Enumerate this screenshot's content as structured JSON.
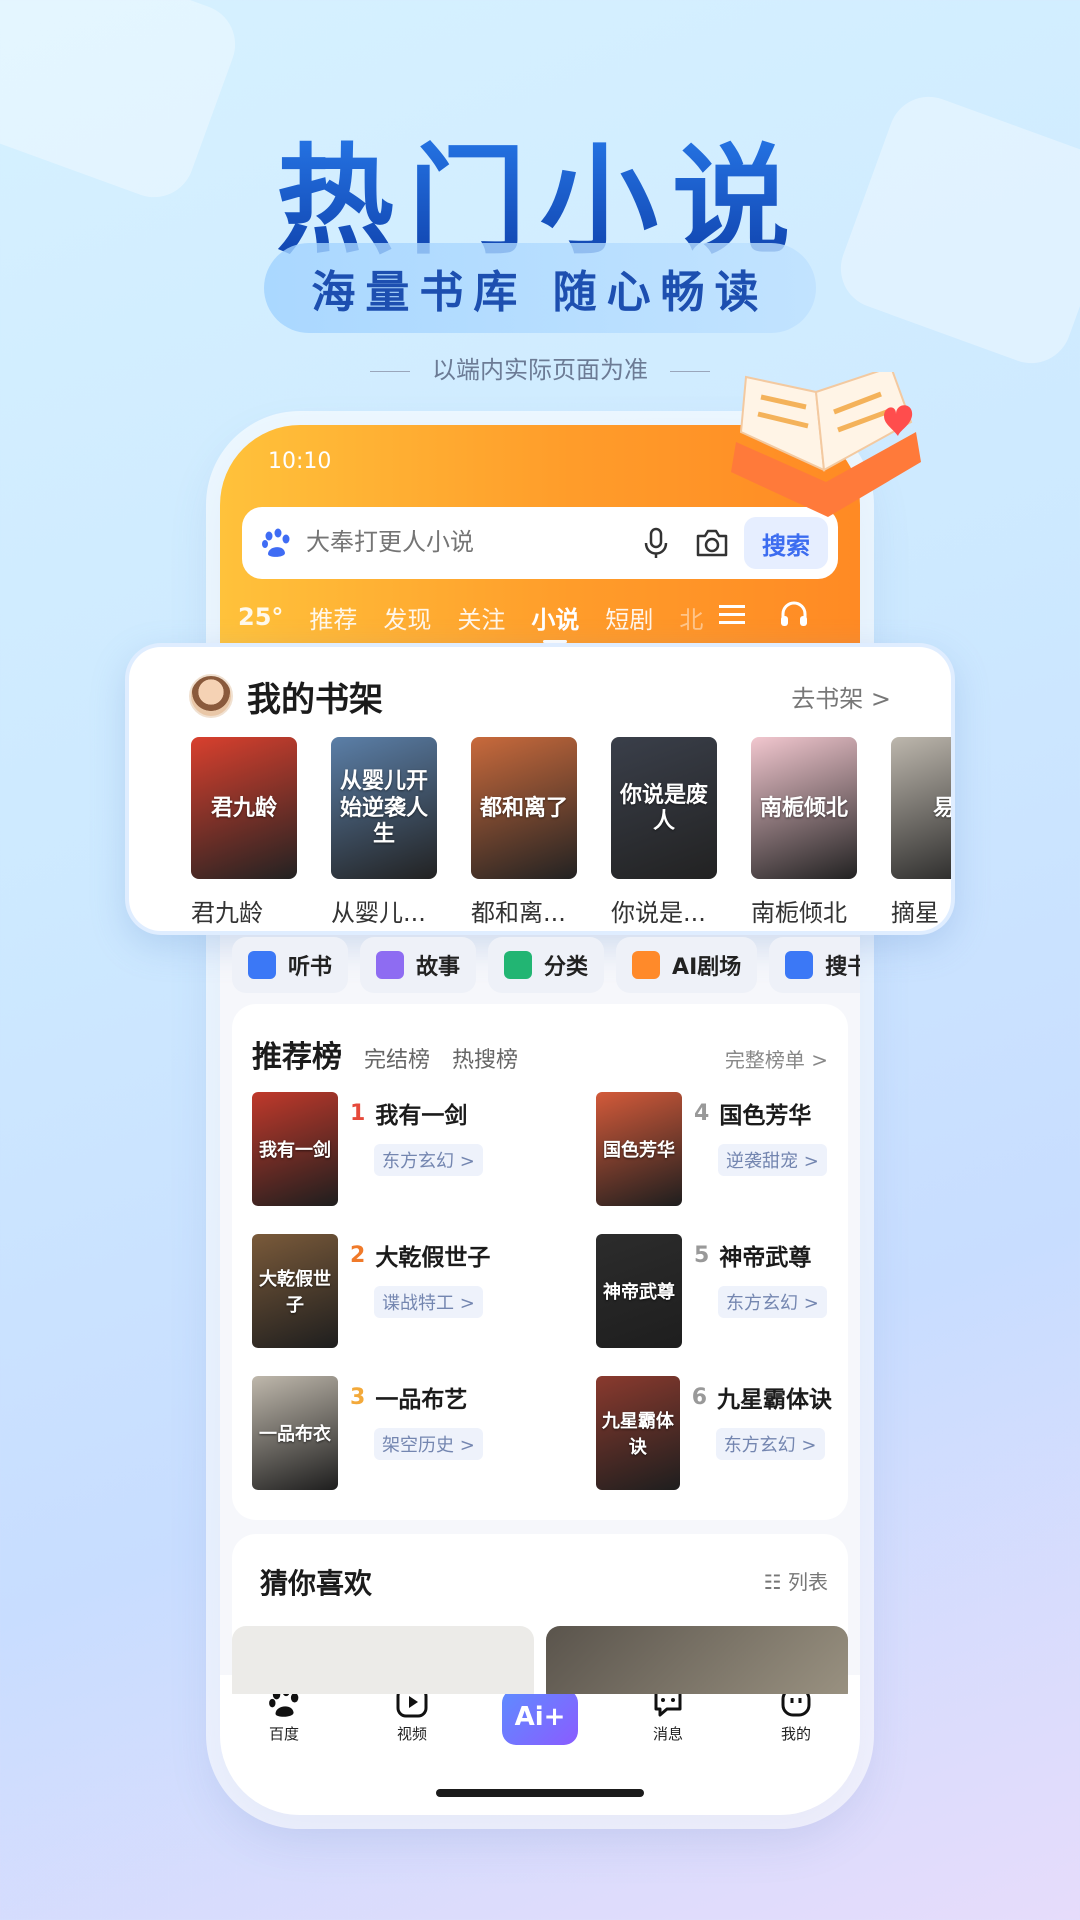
{
  "hero": {
    "title": "热门小说",
    "subtitle": "海量书库  随心畅读",
    "note": "以端内实际页面为准"
  },
  "status": {
    "time": "10:10"
  },
  "search": {
    "placeholder": "大奉打更人小说",
    "button": "搜索"
  },
  "top_tabs": {
    "temperature": "25°",
    "items": [
      "推荐",
      "发现",
      "关注",
      "小说",
      "短剧",
      "北"
    ],
    "active": "小说"
  },
  "shelf": {
    "title": "我的书架",
    "link": "去书架 >",
    "books": [
      {
        "name": "君九龄",
        "cover_text": "君九龄",
        "color": "#d9402e"
      },
      {
        "name": "从婴儿...",
        "cover_text": "从婴儿开始逆袭人生",
        "color": "#5b7fa8"
      },
      {
        "name": "都和离...",
        "cover_text": "都和离了",
        "color": "#c96a3c"
      },
      {
        "name": "你说是...",
        "cover_text": "你说是废人",
        "color": "#3a3f4a"
      },
      {
        "name": "南栀倾北",
        "cover_text": "南栀倾北",
        "color": "#f2c7cf"
      },
      {
        "name": "摘星",
        "cover_text": "易",
        "color": "#bdb7ad"
      }
    ]
  },
  "features": [
    {
      "label": "听书",
      "color": "#3b78f6"
    },
    {
      "label": "故事",
      "color": "#8e6cf2"
    },
    {
      "label": "分类",
      "color": "#22b573"
    },
    {
      "label": "AI剧场",
      "color": "#ff8a2a"
    },
    {
      "label": "搜书",
      "color": "#3b78f6"
    }
  ],
  "ranking": {
    "tab_main": "推荐榜",
    "tabs": [
      "完结榜",
      "热搜榜"
    ],
    "more": "完整榜单 >",
    "items": [
      {
        "rank": "1",
        "title": "我有一剑",
        "tag": "东方玄幻 >",
        "cover_text": "我有一剑",
        "color": "#c0392b",
        "rank_color": "#e64a3b"
      },
      {
        "rank": "4",
        "title": "国色芳华",
        "tag": "逆袭甜宠 >",
        "cover_text": "国色芳华",
        "color": "#d35a3a",
        "rank_color": "#999999"
      },
      {
        "rank": "2",
        "title": "大乾假世子",
        "tag": "谍战特工 >",
        "cover_text": "大乾假世子",
        "color": "#7a5a3a",
        "rank_color": "#f07a2a"
      },
      {
        "rank": "5",
        "title": "神帝武尊",
        "tag": "东方玄幻 >",
        "cover_text": "神帝武尊",
        "color": "#2c2c2c",
        "rank_color": "#999999"
      },
      {
        "rank": "3",
        "title": "一品布艺",
        "tag": "架空历史 >",
        "cover_text": "一品布衣",
        "color": "#bfb8ac",
        "rank_color": "#f3a93a"
      },
      {
        "rank": "6",
        "title": "九星霸体诀",
        "tag": "东方玄幻 >",
        "cover_text": "九星霸体诀",
        "color": "#8a3a2e",
        "rank_color": "#999999"
      }
    ]
  },
  "guess": {
    "title": "猜你喜欢",
    "view_toggle": "列表"
  },
  "bottom_nav": {
    "items": [
      "百度",
      "视频",
      "消息",
      "我的"
    ],
    "ai_label": "Ai+"
  },
  "colors": {
    "accent_orange": "#ff9c2a",
    "brand_blue": "#3c6cf0"
  }
}
